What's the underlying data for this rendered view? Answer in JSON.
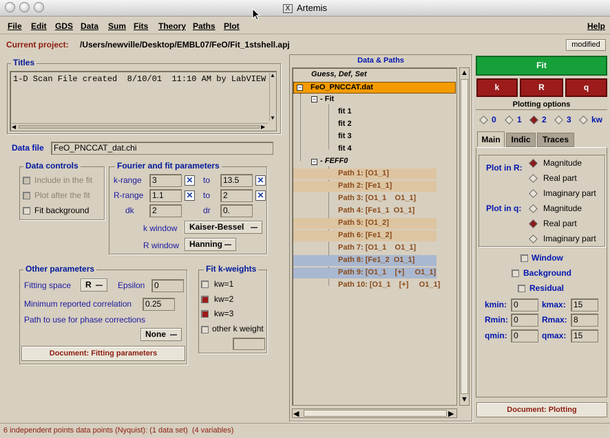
{
  "window": {
    "title": "Artemis"
  },
  "menu": [
    "File",
    "Edit",
    "GDS",
    "Data",
    "Sum",
    "Fits",
    "Theory",
    "Paths",
    "Plot",
    "Help"
  ],
  "project": {
    "label": "Current project:",
    "path": "/Users/newville/Desktop/EMBL07/FeO/Fit_1stshell.apj",
    "status": "modified"
  },
  "titles": {
    "heading": "Titles",
    "text": "1-D Scan File created  8/10/01  11:10 AM by LabVIEW"
  },
  "data_file": {
    "label": "Data file",
    "value": "FeO_PNCCAT_dat.chi"
  },
  "data_controls": {
    "heading": "Data controls",
    "include": "Include in the fit",
    "plot_after": "Plot after the fit",
    "fit_bg": "Fit background"
  },
  "fourier": {
    "heading": "Fourier and fit parameters",
    "k_range": {
      "label": "k-range",
      "from": "3",
      "to_label": "to",
      "to": "13.5"
    },
    "r_range": {
      "label": "R-range",
      "from": "1.1",
      "to_label": "to",
      "to": "2"
    },
    "dk": {
      "label": "dk",
      "value": "2"
    },
    "dr": {
      "label": "dr",
      "value": "0."
    },
    "k_window": {
      "label": "k window",
      "value": "Kaiser-Bessel"
    },
    "r_window": {
      "label": "R window",
      "value": "Hanning"
    }
  },
  "other": {
    "heading": "Other parameters",
    "fitting_space": "Fitting space",
    "space_value": "R",
    "epsilon": "Epsilon",
    "epsilon_value": "0",
    "min_corr": "Minimum reported correlation",
    "min_corr_value": "0.25",
    "phase_path": "Path to use for phase corrections",
    "phase_value": "None",
    "doc_button": "Document: Fitting parameters"
  },
  "kweights": {
    "heading": "Fit k-weights",
    "kw1": "kw=1",
    "kw2": "kw=2",
    "kw3": "kw=3",
    "other": "other k weight"
  },
  "tree": {
    "heading": "Data & Paths",
    "gds": "Guess, Def, Set",
    "dataset": "FeO_PNCCAT.dat",
    "fit_group": "Fit",
    "fits": [
      "fit 1",
      "fit 2",
      "fit 3",
      "fit 4"
    ],
    "feff_group": "FEFF0",
    "paths": [
      {
        "label": "Path 1: [O1_1]",
        "highlight": "tan"
      },
      {
        "label": "Path 2: [Fe1_1]",
        "highlight": "tan"
      },
      {
        "label": "Path 3: [O1_1    O1_1]",
        "highlight": "none"
      },
      {
        "label": "Path 4: [Fe1_1  O1_1]",
        "highlight": "none"
      },
      {
        "label": "Path 5: [O1_2]",
        "highlight": "tan"
      },
      {
        "label": "Path 6: [Fe1_2]",
        "highlight": "tan"
      },
      {
        "label": "Path 7: [O1_1    O1_1]",
        "highlight": "none"
      },
      {
        "label": "Path 8: [Fe1_2  O1_1]",
        "highlight": "blue"
      },
      {
        "label": "Path 9: [O1_1    [+]     O1_1]",
        "highlight": "blue"
      },
      {
        "label": "Path 10: [O1_1    [+]     O1_1]",
        "highlight": "none"
      }
    ]
  },
  "right": {
    "fit_button": "Fit",
    "plot_buttons": [
      "k",
      "R",
      "q"
    ],
    "plotting_options": "Plotting options",
    "kw_options": [
      "0",
      "1",
      "2",
      "3",
      "kw"
    ],
    "tabs": [
      "Main",
      "Indic",
      "Traces"
    ],
    "plot_in_r": "Plot in R:",
    "plot_in_q": "Plot in q:",
    "r_options": [
      "Magnitude",
      "Real part",
      "Imaginary part"
    ],
    "q_options": [
      "Magnitude",
      "Real part",
      "Imaginary part"
    ],
    "window": "Window",
    "background": "Background",
    "residual": "Residual",
    "kmin": {
      "label": "kmin:",
      "value": "0"
    },
    "kmax": {
      "label": "kmax:",
      "value": "15"
    },
    "rmin": {
      "label": "Rmin:",
      "value": "0"
    },
    "rmax": {
      "label": "Rmax:",
      "value": "8"
    },
    "qmin": {
      "label": "qmin:",
      "value": "0"
    },
    "qmax": {
      "label": "qmax:",
      "value": "15"
    },
    "doc_button": "Document: Plotting"
  },
  "status": "6 independent points data points (Nyquist): (1 data set)  (4 variables)"
}
